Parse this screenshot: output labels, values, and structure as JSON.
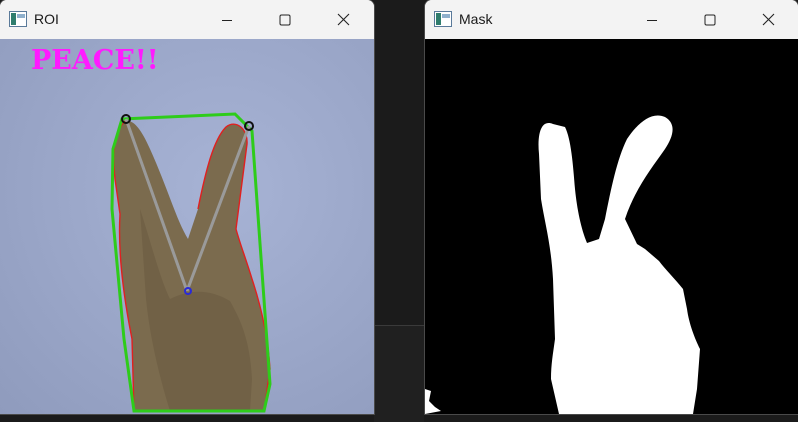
{
  "windows": {
    "roi": {
      "title": "ROI",
      "overlay_text": "PEACE!!",
      "overlay_color": "#ff1aff",
      "hull_color": "#2ecc1a",
      "contour_color": "#e02020"
    },
    "mask": {
      "title": "Mask"
    }
  },
  "controls": {
    "minimize_icon": "minimize-icon",
    "maximize_icon": "maximize-icon",
    "close_icon": "close-icon"
  }
}
